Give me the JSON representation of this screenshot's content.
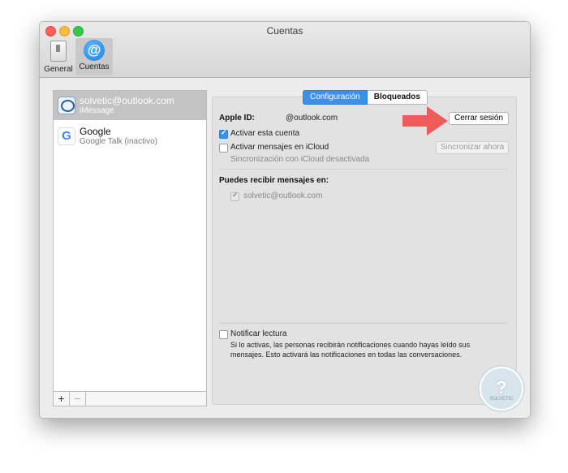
{
  "window": {
    "title": "Cuentas"
  },
  "toolbar": {
    "general_label": "General",
    "cuentas_label": "Cuentas"
  },
  "accounts": [
    {
      "name": "solvetic@outlook.com",
      "service": "iMessage"
    },
    {
      "name": "Google",
      "service": "Google Talk (inactivo)"
    }
  ],
  "sidebar": {
    "add_label": "+",
    "remove_label": "−"
  },
  "tabs": {
    "configuracion": "Configuración",
    "bloqueados": "Bloqueados"
  },
  "settings": {
    "apple_id_label": "Apple ID:",
    "apple_id_value": "@outlook.com",
    "sign_out_button": "Cerrar sesión",
    "activate_account": "Activar esta cuenta",
    "icloud_messages": "Activar mensajes en iCloud",
    "sync_now_button": "Sincronizar ahora",
    "icloud_sync_status": "Sincronización con iCloud desactivada",
    "receive_label": "Puedes recibir mensajes en:",
    "receive_address": "solvetic@outlook.com",
    "read_receipts_label": "Notificar lectura",
    "read_receipts_desc_1": "Si lo activas, las personas recibirán notificaciones cuando hayas leído sus",
    "read_receipts_desc_2": "mensajes. Esto activará las notificaciones en todas las conversaciones."
  },
  "watermark": {
    "symbol": "?",
    "brand": "SOLVETIC"
  },
  "colors": {
    "accent": "#3d8fe8",
    "arrow": "#ef5b5b",
    "selection": "#c3c3c3"
  },
  "icons": [
    "switch-icon",
    "at-sign-icon",
    "imessage-icon",
    "google-icon",
    "checkbox-checked-icon",
    "arrow-right-icon"
  ]
}
